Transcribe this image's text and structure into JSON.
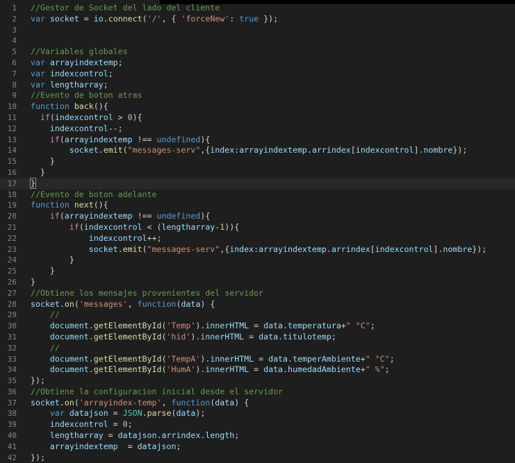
{
  "editor": {
    "lines": [
      {
        "n": "1",
        "indent": 0,
        "tokens": [
          {
            "t": "//Gestor de Socket del lado del cliente",
            "c": "comment"
          }
        ]
      },
      {
        "n": "2",
        "indent": 0,
        "tokens": [
          {
            "t": "var",
            "c": "kw"
          },
          {
            "t": " ",
            "c": "pun"
          },
          {
            "t": "socket",
            "c": "var"
          },
          {
            "t": " = ",
            "c": "pun"
          },
          {
            "t": "io",
            "c": "var"
          },
          {
            "t": ".",
            "c": "pun"
          },
          {
            "t": "connect",
            "c": "fn"
          },
          {
            "t": "(",
            "c": "pun"
          },
          {
            "t": "'/'",
            "c": "str"
          },
          {
            "t": ", { ",
            "c": "pun"
          },
          {
            "t": "'forceNew'",
            "c": "str"
          },
          {
            "t": ": ",
            "c": "pun"
          },
          {
            "t": "true",
            "c": "kw"
          },
          {
            "t": " });",
            "c": "pun"
          }
        ]
      },
      {
        "n": "3",
        "indent": 0,
        "tokens": []
      },
      {
        "n": "4",
        "indent": 0,
        "tokens": []
      },
      {
        "n": "5",
        "indent": 0,
        "tokens": [
          {
            "t": "//Variables globales",
            "c": "comment"
          }
        ]
      },
      {
        "n": "6",
        "indent": 0,
        "tokens": [
          {
            "t": "var",
            "c": "kw"
          },
          {
            "t": " ",
            "c": "pun"
          },
          {
            "t": "arrayindextemp",
            "c": "var"
          },
          {
            "t": ";",
            "c": "pun"
          }
        ]
      },
      {
        "n": "7",
        "indent": 0,
        "tokens": [
          {
            "t": "var",
            "c": "kw"
          },
          {
            "t": " ",
            "c": "pun"
          },
          {
            "t": "indexcontrol",
            "c": "var"
          },
          {
            "t": ";",
            "c": "pun"
          }
        ]
      },
      {
        "n": "8",
        "indent": 0,
        "tokens": [
          {
            "t": "var",
            "c": "kw"
          },
          {
            "t": " ",
            "c": "pun"
          },
          {
            "t": "lengtharray",
            "c": "var"
          },
          {
            "t": ";",
            "c": "pun"
          }
        ]
      },
      {
        "n": "9",
        "indent": 0,
        "tokens": [
          {
            "t": "//Evento de boton atras",
            "c": "comment"
          }
        ]
      },
      {
        "n": "10",
        "indent": 0,
        "tokens": [
          {
            "t": "function",
            "c": "kw"
          },
          {
            "t": " ",
            "c": "pun"
          },
          {
            "t": "back",
            "c": "fn"
          },
          {
            "t": "(){",
            "c": "pun"
          }
        ]
      },
      {
        "n": "11",
        "indent": 1,
        "tokens": [
          {
            "t": "if",
            "c": "ctrl"
          },
          {
            "t": "(",
            "c": "pun"
          },
          {
            "t": "indexcontrol",
            "c": "var"
          },
          {
            "t": " > ",
            "c": "pun"
          },
          {
            "t": "0",
            "c": "num"
          },
          {
            "t": "){",
            "c": "pun"
          }
        ]
      },
      {
        "n": "12",
        "indent": 2,
        "tokens": [
          {
            "t": "indexcontrol",
            "c": "var"
          },
          {
            "t": "--;",
            "c": "pun"
          }
        ]
      },
      {
        "n": "13",
        "indent": 2,
        "tokens": [
          {
            "t": "if",
            "c": "ctrl"
          },
          {
            "t": "(",
            "c": "pun"
          },
          {
            "t": "arrayindextemp",
            "c": "var"
          },
          {
            "t": " !== ",
            "c": "pun"
          },
          {
            "t": "undefined",
            "c": "kw"
          },
          {
            "t": "){",
            "c": "pun"
          }
        ]
      },
      {
        "n": "14",
        "indent": 4,
        "tokens": [
          {
            "t": "socket",
            "c": "var"
          },
          {
            "t": ".",
            "c": "pun"
          },
          {
            "t": "emit",
            "c": "fn"
          },
          {
            "t": "(",
            "c": "pun"
          },
          {
            "t": "\"messages-serv\"",
            "c": "str"
          },
          {
            "t": ",{",
            "c": "pun"
          },
          {
            "t": "index",
            "c": "var"
          },
          {
            "t": ":",
            "c": "pun"
          },
          {
            "t": "arrayindextemp",
            "c": "var"
          },
          {
            "t": ".",
            "c": "pun"
          },
          {
            "t": "arrindex",
            "c": "var"
          },
          {
            "t": "[",
            "c": "pun"
          },
          {
            "t": "indexcontrol",
            "c": "var"
          },
          {
            "t": "].",
            "c": "pun"
          },
          {
            "t": "nombre",
            "c": "var"
          },
          {
            "t": "});",
            "c": "pun"
          }
        ]
      },
      {
        "n": "15",
        "indent": 2,
        "tokens": [
          {
            "t": "}",
            "c": "pun"
          }
        ]
      },
      {
        "n": "16",
        "indent": 1,
        "tokens": [
          {
            "t": "}",
            "c": "pun"
          }
        ]
      },
      {
        "n": "17",
        "indent": 0,
        "current": true,
        "tokens": [
          {
            "t": "}",
            "c": "pun bm"
          }
        ]
      },
      {
        "n": "18",
        "indent": 0,
        "tokens": [
          {
            "t": "//Evento de boton adelante",
            "c": "comment"
          }
        ]
      },
      {
        "n": "19",
        "indent": 0,
        "tokens": [
          {
            "t": "function",
            "c": "kw"
          },
          {
            "t": " ",
            "c": "pun"
          },
          {
            "t": "next",
            "c": "fn"
          },
          {
            "t": "(){",
            "c": "pun"
          }
        ]
      },
      {
        "n": "20",
        "indent": 2,
        "tokens": [
          {
            "t": "if",
            "c": "ctrl"
          },
          {
            "t": "(",
            "c": "pun"
          },
          {
            "t": "arrayindextemp",
            "c": "var"
          },
          {
            "t": " !== ",
            "c": "pun"
          },
          {
            "t": "undefined",
            "c": "kw"
          },
          {
            "t": "){",
            "c": "pun"
          }
        ]
      },
      {
        "n": "21",
        "indent": 4,
        "tokens": [
          {
            "t": "if",
            "c": "ctrl"
          },
          {
            "t": "(",
            "c": "pun"
          },
          {
            "t": "indexcontrol",
            "c": "var"
          },
          {
            "t": " < (",
            "c": "pun"
          },
          {
            "t": "lengtharray",
            "c": "var"
          },
          {
            "t": "-",
            "c": "pun"
          },
          {
            "t": "1",
            "c": "num"
          },
          {
            "t": ")){",
            "c": "pun"
          }
        ]
      },
      {
        "n": "22",
        "indent": 6,
        "tokens": [
          {
            "t": "indexcontrol",
            "c": "var"
          },
          {
            "t": "++;",
            "c": "pun"
          }
        ]
      },
      {
        "n": "23",
        "indent": 6,
        "tokens": [
          {
            "t": "socket",
            "c": "var"
          },
          {
            "t": ".",
            "c": "pun"
          },
          {
            "t": "emit",
            "c": "fn"
          },
          {
            "t": "(",
            "c": "pun"
          },
          {
            "t": "\"messages-serv\"",
            "c": "str"
          },
          {
            "t": ",{",
            "c": "pun"
          },
          {
            "t": "index",
            "c": "var"
          },
          {
            "t": ":",
            "c": "pun"
          },
          {
            "t": "arrayindextemp",
            "c": "var"
          },
          {
            "t": ".",
            "c": "pun"
          },
          {
            "t": "arrindex",
            "c": "var"
          },
          {
            "t": "[",
            "c": "pun"
          },
          {
            "t": "indexcontrol",
            "c": "var"
          },
          {
            "t": "].",
            "c": "pun"
          },
          {
            "t": "nombre",
            "c": "var"
          },
          {
            "t": "});",
            "c": "pun"
          }
        ]
      },
      {
        "n": "24",
        "indent": 4,
        "tokens": [
          {
            "t": "}",
            "c": "pun"
          }
        ]
      },
      {
        "n": "25",
        "indent": 2,
        "tokens": [
          {
            "t": "}",
            "c": "pun"
          }
        ]
      },
      {
        "n": "26",
        "indent": 0,
        "tokens": [
          {
            "t": "}",
            "c": "pun"
          }
        ]
      },
      {
        "n": "27",
        "indent": 0,
        "tokens": [
          {
            "t": "//Obtiene los mensajes provenientes del servidor",
            "c": "comment"
          }
        ]
      },
      {
        "n": "28",
        "indent": 0,
        "tokens": [
          {
            "t": "socket",
            "c": "var"
          },
          {
            "t": ".",
            "c": "pun"
          },
          {
            "t": "on",
            "c": "fn"
          },
          {
            "t": "(",
            "c": "pun"
          },
          {
            "t": "'messages'",
            "c": "str"
          },
          {
            "t": ", ",
            "c": "pun"
          },
          {
            "t": "function",
            "c": "kw"
          },
          {
            "t": "(",
            "c": "pun"
          },
          {
            "t": "data",
            "c": "var"
          },
          {
            "t": ") {",
            "c": "pun"
          }
        ]
      },
      {
        "n": "29",
        "indent": 2,
        "tokens": [
          {
            "t": "//",
            "c": "comment"
          }
        ]
      },
      {
        "n": "30",
        "indent": 2,
        "tokens": [
          {
            "t": "document",
            "c": "var"
          },
          {
            "t": ".",
            "c": "pun"
          },
          {
            "t": "getElementById",
            "c": "fn"
          },
          {
            "t": "(",
            "c": "pun"
          },
          {
            "t": "'Temp'",
            "c": "str"
          },
          {
            "t": ").",
            "c": "pun"
          },
          {
            "t": "innerHTML",
            "c": "var"
          },
          {
            "t": " = ",
            "c": "pun"
          },
          {
            "t": "data",
            "c": "var"
          },
          {
            "t": ".",
            "c": "pun"
          },
          {
            "t": "temperatura",
            "c": "var"
          },
          {
            "t": "+",
            "c": "pun"
          },
          {
            "t": "\" °C\"",
            "c": "str"
          },
          {
            "t": ";",
            "c": "pun"
          }
        ]
      },
      {
        "n": "31",
        "indent": 2,
        "tokens": [
          {
            "t": "document",
            "c": "var"
          },
          {
            "t": ".",
            "c": "pun"
          },
          {
            "t": "getElementById",
            "c": "fn"
          },
          {
            "t": "(",
            "c": "pun"
          },
          {
            "t": "'hid'",
            "c": "str"
          },
          {
            "t": ").",
            "c": "pun"
          },
          {
            "t": "innerHTML",
            "c": "var"
          },
          {
            "t": " = ",
            "c": "pun"
          },
          {
            "t": "data",
            "c": "var"
          },
          {
            "t": ".",
            "c": "pun"
          },
          {
            "t": "titulotemp",
            "c": "var"
          },
          {
            "t": ";",
            "c": "pun"
          }
        ]
      },
      {
        "n": "32",
        "indent": 2,
        "tokens": [
          {
            "t": "//",
            "c": "comment"
          }
        ]
      },
      {
        "n": "33",
        "indent": 2,
        "tokens": [
          {
            "t": "document",
            "c": "var"
          },
          {
            "t": ".",
            "c": "pun"
          },
          {
            "t": "getElementById",
            "c": "fn"
          },
          {
            "t": "(",
            "c": "pun"
          },
          {
            "t": "'TempA'",
            "c": "str"
          },
          {
            "t": ").",
            "c": "pun"
          },
          {
            "t": "innerHTML",
            "c": "var"
          },
          {
            "t": " = ",
            "c": "pun"
          },
          {
            "t": "data",
            "c": "var"
          },
          {
            "t": ".",
            "c": "pun"
          },
          {
            "t": "temperAmbiente",
            "c": "var"
          },
          {
            "t": "+",
            "c": "pun"
          },
          {
            "t": "\" °C\"",
            "c": "str"
          },
          {
            "t": ";",
            "c": "pun"
          }
        ]
      },
      {
        "n": "34",
        "indent": 2,
        "tokens": [
          {
            "t": "document",
            "c": "var"
          },
          {
            "t": ".",
            "c": "pun"
          },
          {
            "t": "getElementById",
            "c": "fn"
          },
          {
            "t": "(",
            "c": "pun"
          },
          {
            "t": "'HumA'",
            "c": "str"
          },
          {
            "t": ").",
            "c": "pun"
          },
          {
            "t": "innerHTML",
            "c": "var"
          },
          {
            "t": " = ",
            "c": "pun"
          },
          {
            "t": "data",
            "c": "var"
          },
          {
            "t": ".",
            "c": "pun"
          },
          {
            "t": "humedadAmbiente",
            "c": "var"
          },
          {
            "t": "+",
            "c": "pun"
          },
          {
            "t": "\" %\"",
            "c": "str"
          },
          {
            "t": ";",
            "c": "pun"
          }
        ]
      },
      {
        "n": "35",
        "indent": 0,
        "tokens": [
          {
            "t": "});",
            "c": "pun"
          }
        ]
      },
      {
        "n": "36",
        "indent": 0,
        "tokens": [
          {
            "t": "//Obtiene la configuracion inicial desde el servidor",
            "c": "comment"
          }
        ]
      },
      {
        "n": "37",
        "indent": 0,
        "tokens": [
          {
            "t": "socket",
            "c": "var"
          },
          {
            "t": ".",
            "c": "pun"
          },
          {
            "t": "on",
            "c": "fn"
          },
          {
            "t": "(",
            "c": "pun"
          },
          {
            "t": "'arrayindex-temp'",
            "c": "str"
          },
          {
            "t": ", ",
            "c": "pun"
          },
          {
            "t": "function",
            "c": "kw"
          },
          {
            "t": "(",
            "c": "pun"
          },
          {
            "t": "data",
            "c": "var"
          },
          {
            "t": ") {",
            "c": "pun"
          }
        ]
      },
      {
        "n": "38",
        "indent": 2,
        "tokens": [
          {
            "t": "var",
            "c": "kw"
          },
          {
            "t": " ",
            "c": "pun"
          },
          {
            "t": "datajson",
            "c": "var"
          },
          {
            "t": " = ",
            "c": "pun"
          },
          {
            "t": "JSON",
            "c": "cls"
          },
          {
            "t": ".",
            "c": "pun"
          },
          {
            "t": "parse",
            "c": "fn"
          },
          {
            "t": "(",
            "c": "pun"
          },
          {
            "t": "data",
            "c": "var"
          },
          {
            "t": ");",
            "c": "pun"
          }
        ]
      },
      {
        "n": "39",
        "indent": 2,
        "tokens": [
          {
            "t": "indexcontrol",
            "c": "var"
          },
          {
            "t": " = ",
            "c": "pun"
          },
          {
            "t": "0",
            "c": "num"
          },
          {
            "t": ";",
            "c": "pun"
          }
        ]
      },
      {
        "n": "40",
        "indent": 2,
        "tokens": [
          {
            "t": "lengtharray",
            "c": "var"
          },
          {
            "t": " = ",
            "c": "pun"
          },
          {
            "t": "datajson",
            "c": "var"
          },
          {
            "t": ".",
            "c": "pun"
          },
          {
            "t": "arrindex",
            "c": "var"
          },
          {
            "t": ".",
            "c": "pun"
          },
          {
            "t": "length",
            "c": "var"
          },
          {
            "t": ";",
            "c": "pun"
          }
        ]
      },
      {
        "n": "41",
        "indent": 2,
        "tokens": [
          {
            "t": "arrayindextemp",
            "c": "var"
          },
          {
            "t": "  = ",
            "c": "pun"
          },
          {
            "t": "datajson",
            "c": "var"
          },
          {
            "t": ";",
            "c": "pun"
          }
        ]
      },
      {
        "n": "42",
        "indent": 0,
        "tokens": [
          {
            "t": "});",
            "c": "pun"
          }
        ]
      }
    ]
  }
}
